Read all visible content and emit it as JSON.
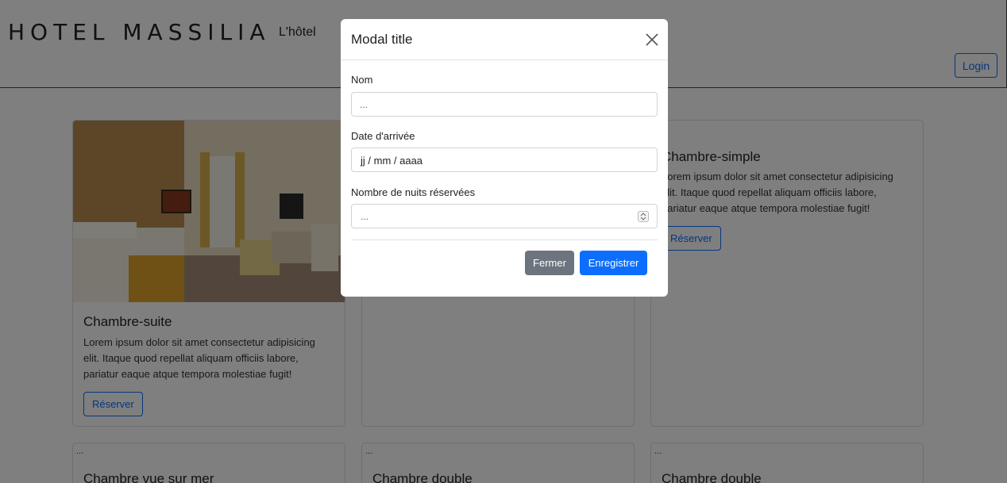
{
  "navbar": {
    "brand": "HOTEL MASSILIA",
    "nav_link": "L'hôtel",
    "login_label": "Login"
  },
  "cards": [
    {
      "title": "Chambre-suite",
      "text": "Lorem ipsum dolor sit amet consectetur adipisicing elit. Itaque quod repellat aliquam officiis labore, pariatur eaque atque tempora molestiae fugit!",
      "button": "Réserver"
    },
    {
      "title": "Chambre-simple",
      "text": "Lorem ipsum dolor sit amet consectetur adipisicing elit. Itaque quod repellat aliquam officiis labore, pariatur eaque atque tempora molestiae fugit!",
      "button": "Réserver"
    },
    {
      "img_alt": "...",
      "title": "Chambre vue sur mer"
    },
    {
      "img_alt": "...",
      "title": "Chambre double"
    },
    {
      "img_alt": "...",
      "title": "Chambre double"
    }
  ],
  "modal": {
    "title": "Modal title",
    "name_label": "Nom",
    "name_placeholder": "...",
    "date_label": "Date d'arrivée",
    "date_value": "jj / mm / aaaa",
    "nights_label": "Nombre de nuits réservées",
    "nights_placeholder": "...",
    "close_label": "Fermer",
    "save_label": "Enregistrer"
  },
  "colors": {
    "primary": "#0d6efd",
    "secondary": "#6c757d"
  },
  "icons": [
    "close-icon",
    "spinner-arrows-icon"
  ]
}
